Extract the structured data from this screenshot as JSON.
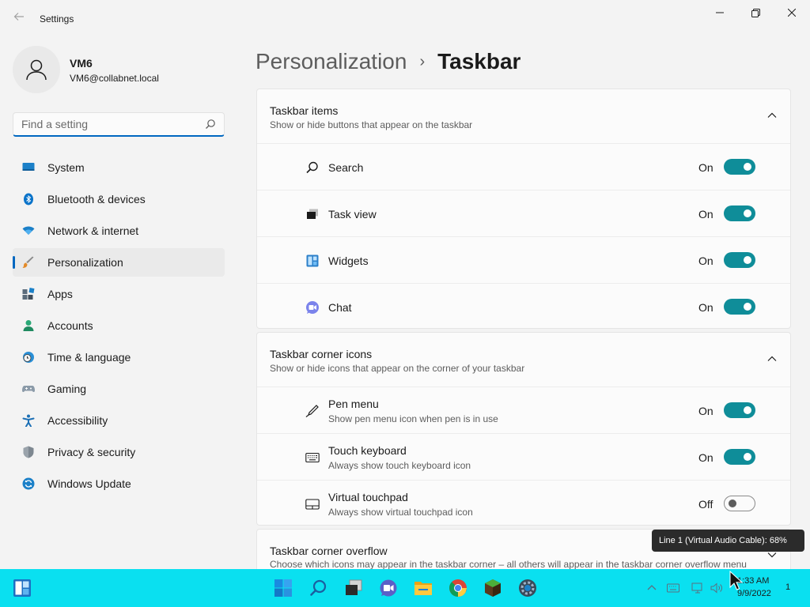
{
  "app": {
    "title": "Settings"
  },
  "profile": {
    "name": "VM6",
    "email": "VM6@collabnet.local"
  },
  "search": {
    "placeholder": "Find a setting"
  },
  "sidebar": {
    "items": [
      {
        "label": "System",
        "icon": "system-icon"
      },
      {
        "label": "Bluetooth & devices",
        "icon": "bluetooth-icon"
      },
      {
        "label": "Network & internet",
        "icon": "wifi-icon"
      },
      {
        "label": "Personalization",
        "icon": "brush-icon",
        "active": true
      },
      {
        "label": "Apps",
        "icon": "apps-icon"
      },
      {
        "label": "Accounts",
        "icon": "person-icon"
      },
      {
        "label": "Time & language",
        "icon": "clock-globe-icon"
      },
      {
        "label": "Gaming",
        "icon": "gamepad-icon"
      },
      {
        "label": "Accessibility",
        "icon": "accessibility-icon"
      },
      {
        "label": "Privacy & security",
        "icon": "shield-icon"
      },
      {
        "label": "Windows Update",
        "icon": "update-icon"
      }
    ]
  },
  "breadcrumb": {
    "parent": "Personalization",
    "separator": "›",
    "current": "Taskbar"
  },
  "sections": {
    "taskbar_items": {
      "title": "Taskbar items",
      "description": "Show or hide buttons that appear on the taskbar",
      "rows": [
        {
          "label": "Search",
          "state": "On",
          "on": true
        },
        {
          "label": "Task view",
          "state": "On",
          "on": true
        },
        {
          "label": "Widgets",
          "state": "On",
          "on": true
        },
        {
          "label": "Chat",
          "state": "On",
          "on": true
        }
      ]
    },
    "corner_icons": {
      "title": "Taskbar corner icons",
      "description": "Show or hide icons that appear on the corner of your taskbar",
      "rows": [
        {
          "label": "Pen menu",
          "sub": "Show pen menu icon when pen is in use",
          "state": "On",
          "on": true
        },
        {
          "label": "Touch keyboard",
          "sub": "Always show touch keyboard icon",
          "state": "On",
          "on": true
        },
        {
          "label": "Virtual touchpad",
          "sub": "Always show virtual touchpad icon",
          "state": "Off",
          "on": false
        }
      ]
    },
    "corner_overflow": {
      "title": "Taskbar corner overflow",
      "description": "Choose which icons may appear in the taskbar corner – all others will appear in the taskbar corner overflow menu"
    }
  },
  "tooltip": {
    "text": "Line 1 (Virtual Audio Cable): 68%"
  },
  "taskbar": {
    "clock_time": "1:33 AM",
    "clock_date": "9/9/2022",
    "notification_count": "1"
  },
  "colors": {
    "accent": "#0f8d99",
    "taskbar": "#0ae0f0",
    "nav_indicator": "#0067c0"
  }
}
